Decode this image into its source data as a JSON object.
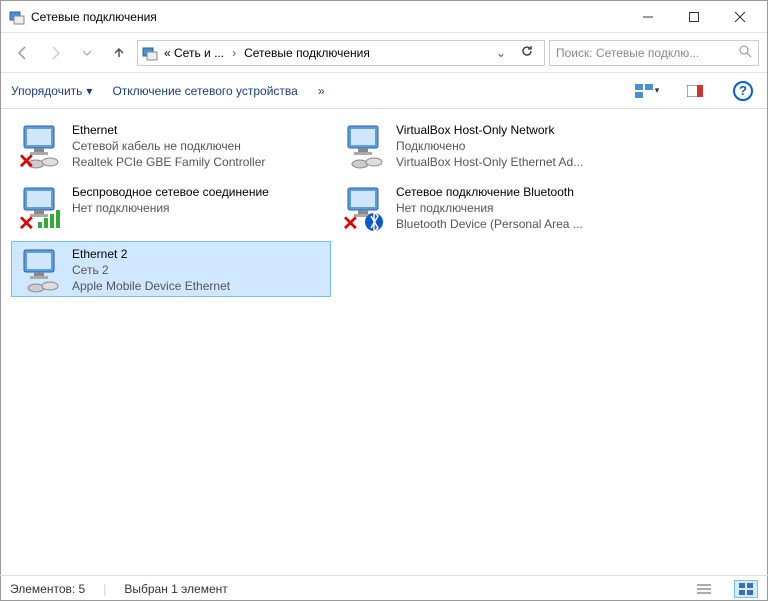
{
  "window": {
    "title": "Сетевые подключения"
  },
  "address": {
    "crumb1": "« Сеть и ...",
    "crumb2": "Сетевые подключения"
  },
  "search": {
    "placeholder": "Поиск: Сетевые подклю..."
  },
  "toolbar": {
    "organize": "Упорядочить",
    "disable": "Отключение сетевого устройства",
    "more": "»"
  },
  "connections": [
    {
      "name": "Ethernet",
      "status": "Сетевой кабель не подключен",
      "device": "Realtek PCIe GBE Family Controller",
      "disconnected": true,
      "selected": false,
      "overlay": "net"
    },
    {
      "name": "VirtualBox Host-Only Network",
      "status": "Подключено",
      "device": "VirtualBox Host-Only Ethernet Ad...",
      "disconnected": false,
      "selected": false,
      "overlay": "net"
    },
    {
      "name": "Беспроводное сетевое соединение",
      "status": "Нет подключения",
      "device": "",
      "disconnected": true,
      "selected": false,
      "overlay": "wifi"
    },
    {
      "name": "Сетевое подключение Bluetooth",
      "status": "Нет подключения",
      "device": "Bluetooth Device (Personal Area ...",
      "disconnected": true,
      "selected": false,
      "overlay": "bluetooth"
    },
    {
      "name": "Ethernet 2",
      "status": "Сеть 2",
      "device": "Apple Mobile Device Ethernet",
      "disconnected": false,
      "selected": true,
      "overlay": "net"
    }
  ],
  "statusbar": {
    "count": "Элементов: 5",
    "selection": "Выбран 1 элемент"
  }
}
